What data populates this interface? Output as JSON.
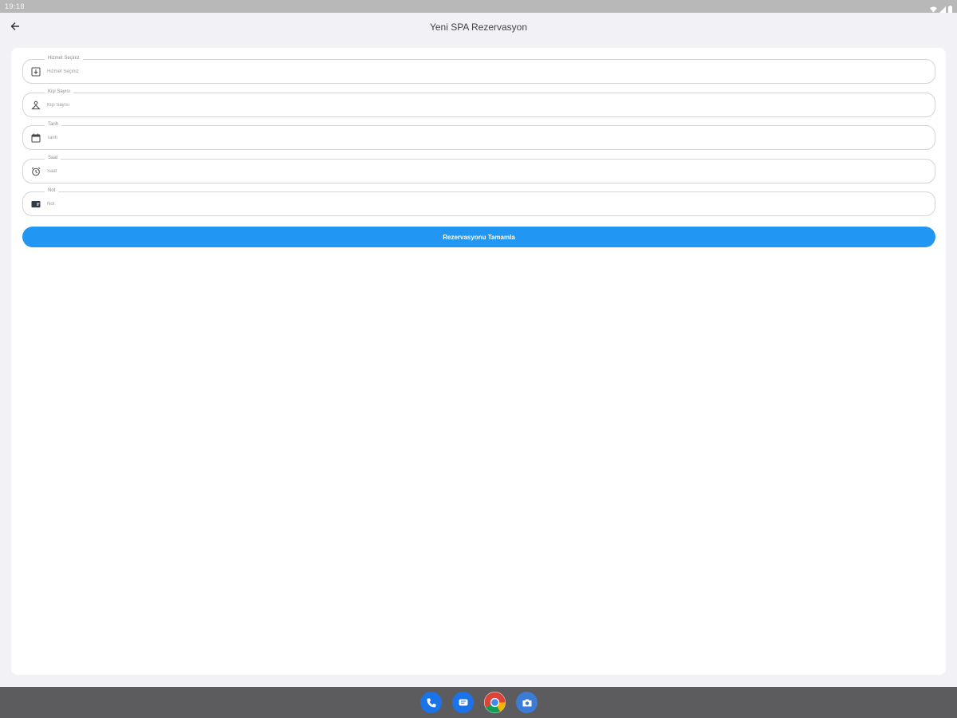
{
  "status_bar": {
    "time": "19:18"
  },
  "app_bar": {
    "title": "Yeni SPA Rezervasyon"
  },
  "form": {
    "fields": [
      {
        "label": "Hizmet Seçiniz",
        "placeholder": "Hizmet Seçiniz",
        "icon": "service-list-icon"
      },
      {
        "label": "Kişi Sayısı",
        "placeholder": "Kişi Sayısı",
        "icon": "person-icon"
      },
      {
        "label": "Tarih",
        "placeholder": "Tarih",
        "icon": "calendar-icon"
      },
      {
        "label": "Saat",
        "placeholder": "Saat",
        "icon": "alarm-clock-icon"
      },
      {
        "label": "Not",
        "placeholder": "Not",
        "icon": "note-icon"
      }
    ],
    "submit_label": "Rezervasyonu Tamamla"
  },
  "dock": [
    "phone-app-icon",
    "messages-app-icon",
    "chrome-app-icon",
    "camera-app-icon"
  ],
  "colors": {
    "accent": "#2196f3",
    "nav_bar": "#5c5c5e",
    "status_bar": "#b8b8b8"
  }
}
